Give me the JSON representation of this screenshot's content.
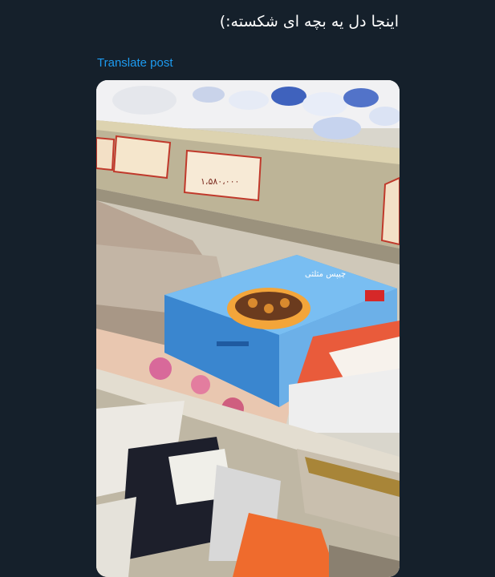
{
  "post": {
    "text": "اینجا دل یه بچه ای شکسته:)",
    "translate_label": "Translate post"
  },
  "media": {
    "price_tags": [
      "۱،۵۸۰،۰۰۰"
    ],
    "cereal_box_label": "چیپس مثلثی"
  },
  "colors": {
    "background": "#15202b",
    "link": "#1d9bf0",
    "text": "#ffffff"
  }
}
